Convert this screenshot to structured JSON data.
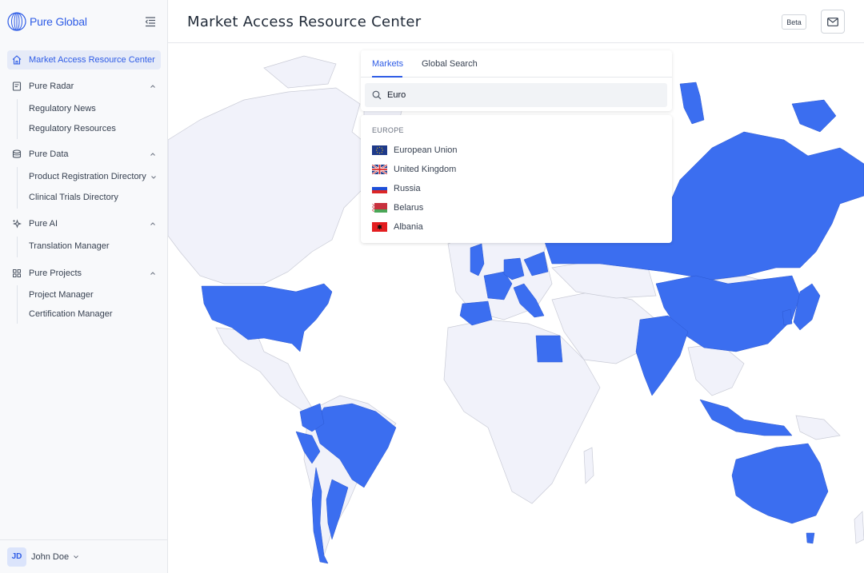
{
  "app": {
    "brand": "Pure Global",
    "page_title": "Market Access Resource Center",
    "beta_badge": "Beta"
  },
  "sidebar": {
    "active_item": {
      "label": "Market Access Resource Center",
      "icon": "home-icon"
    },
    "sections": [
      {
        "label": "Pure Radar",
        "icon": "radar-doc-icon",
        "expanded": true,
        "items": [
          {
            "label": "Regulatory News"
          },
          {
            "label": "Regulatory Resources"
          }
        ]
      },
      {
        "label": "Pure Data",
        "icon": "database-icon",
        "expanded": true,
        "items": [
          {
            "label": "Product Registration Directory",
            "has_submenu": true
          },
          {
            "label": "Clinical Trials Directory"
          }
        ]
      },
      {
        "label": "Pure AI",
        "icon": "sparkle-icon",
        "expanded": true,
        "items": [
          {
            "label": "Translation Manager"
          }
        ]
      },
      {
        "label": "Pure Projects",
        "icon": "grid-icon",
        "expanded": true,
        "items": [
          {
            "label": "Project Manager"
          },
          {
            "label": "Certification Manager"
          }
        ]
      }
    ],
    "user": {
      "initials": "JD",
      "name": "John Doe"
    }
  },
  "search": {
    "tabs": [
      {
        "label": "Markets",
        "active": true
      },
      {
        "label": "Global Search",
        "active": false
      }
    ],
    "query": "Euro",
    "results_group": "EUROPE",
    "results": [
      {
        "label": "European Union",
        "flag": "eu-flag"
      },
      {
        "label": "United Kingdom",
        "flag": "uk-flag"
      },
      {
        "label": "Russia",
        "flag": "russia-flag"
      },
      {
        "label": "Belarus",
        "flag": "belarus-flag"
      },
      {
        "label": "Albania",
        "flag": "albania-flag"
      }
    ]
  },
  "map": {
    "highlighted_markets": [
      "United States",
      "Brazil",
      "Argentina",
      "Chile",
      "Peru",
      "Colombia",
      "Russia",
      "China",
      "India",
      "Australia",
      "Japan",
      "South Korea",
      "Indonesia",
      "Egypt",
      "Canada (Arctic islands)",
      "United Kingdom",
      "France",
      "Spain",
      "Germany",
      "Italy"
    ]
  },
  "colors": {
    "accent": "#2e5ce6",
    "highlight_fill": "#3b6ef0",
    "land_fill": "#f1f2fa",
    "land_stroke": "#c9cbd6",
    "sidebar_bg": "#f8f9fb"
  }
}
